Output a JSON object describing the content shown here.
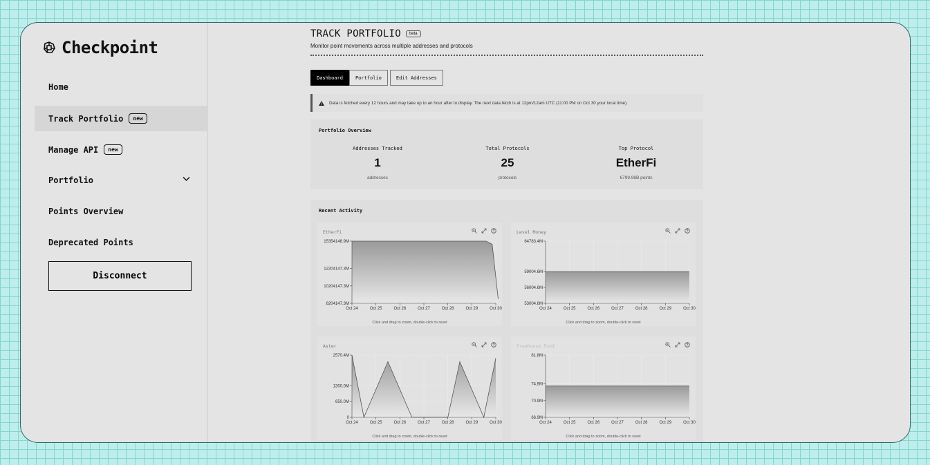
{
  "app": {
    "name": "Checkpoint"
  },
  "sidebar": {
    "items": [
      {
        "label": "Home"
      },
      {
        "label": "Track Portfolio",
        "badge": "new"
      },
      {
        "label": "Manage API",
        "badge": "new"
      },
      {
        "label": "Portfolio"
      },
      {
        "label": "Points Overview"
      },
      {
        "label": "Deprecated Points"
      }
    ],
    "disconnect_label": "Disconnect"
  },
  "page": {
    "title": "TRACK PORTFOLIO",
    "badge": "beta",
    "subtitle": "Monitor point movements across multiple addresses and protocols"
  },
  "tabs": [
    {
      "label": "Dashboard",
      "active": true
    },
    {
      "label": "Portfolio",
      "active": false
    },
    {
      "label": "Edit Addresses",
      "active": false
    }
  ],
  "notice": {
    "text": "Data is fetched every 12 hours and may take up to an hour after to display. The next data fetch is at 12pm/12am UTC (11:00 PM on Oct 30 your local time)."
  },
  "overview": {
    "title": "Portfolio Overview",
    "stats": [
      {
        "label": "Addresses Tracked",
        "value": "1",
        "sub": "addresses"
      },
      {
        "label": "Total Protocols",
        "value": "25",
        "sub": "protocols"
      },
      {
        "label": "Top Protocol",
        "value": "EtherFi",
        "sub": "6799.98B points"
      }
    ]
  },
  "activity": {
    "title": "Recent Activity",
    "chart_hint": "Click and drag to zoom, double-click to reset"
  },
  "chart_data": [
    {
      "type": "area",
      "title": "EtherFi",
      "x": [
        "Oct 24",
        "Oct 25",
        "Oct 26",
        "Oct 27",
        "Oct 28",
        "Oct 29",
        "Oct 30"
      ],
      "y_ticks": [
        "15354148.9M",
        "12204147.3M",
        "10204147.3M",
        "8204147.3M"
      ],
      "y_tick_values": [
        15354148.9,
        12204147.3,
        10204147.3,
        8204147.3
      ],
      "ylim": [
        8204147.3,
        15354148.9
      ],
      "series": [
        {
          "values": [
            15354148.9,
            15354148.9,
            15354148.9,
            15354148.9,
            15354148.9,
            15354148.9,
            15354148.9,
            15354148.9,
            15354148.9,
            15354148.9,
            15354148.9,
            15354148.9,
            15354148.9,
            15000000,
            8700000
          ],
          "x_pos": [
            0,
            0.5,
            1,
            1.5,
            2,
            2.5,
            3,
            3.5,
            4,
            4.5,
            5,
            5.4,
            5.6,
            5.85,
            6.1
          ]
        }
      ]
    },
    {
      "type": "area",
      "title": "Level Money",
      "x": [
        "Oct 24",
        "Oct 25",
        "Oct 26",
        "Oct 27",
        "Oct 28",
        "Oct 29",
        "Oct 30"
      ],
      "y_ticks": [
        "64783.4M",
        "59004.6M",
        "56004.6M",
        "53004.6M"
      ],
      "y_tick_values": [
        64783.4,
        59004.6,
        56004.6,
        53004.6
      ],
      "ylim": [
        53004.6,
        64783.4
      ],
      "series": [
        {
          "values": [
            59004.6,
            59004.6,
            59004.6,
            59004.6,
            59004.6,
            59004.6,
            59004.6
          ],
          "x_pos": [
            0,
            1,
            2,
            3,
            4,
            5,
            6
          ]
        }
      ]
    },
    {
      "type": "area",
      "title": "Aster",
      "x": [
        "Oct 24",
        "Oct 25",
        "Oct 26",
        "Oct 27",
        "Oct 28",
        "Oct 29",
        "Oct 30"
      ],
      "y_ticks": [
        "2570.4M",
        "1300.0M",
        "650.0M",
        "0"
      ],
      "y_tick_values": [
        2570.4,
        1300,
        650,
        0
      ],
      "ylim": [
        0,
        2570.4
      ],
      "series": [
        {
          "values": [
            2570.4,
            0,
            2300,
            0,
            0,
            0,
            0,
            2300,
            0,
            2450
          ],
          "x_pos": [
            0,
            0.5,
            1.5,
            2.5,
            3,
            3.5,
            4,
            4.5,
            5.5,
            6
          ]
        }
      ]
    },
    {
      "type": "area",
      "title": "Treehouse Fund",
      "x": [
        "Oct 24",
        "Oct 25",
        "Oct 26",
        "Oct 27",
        "Oct 28",
        "Oct 29",
        "Oct 30"
      ],
      "y_ticks": [
        "81.8M",
        "74.9M",
        "70.9M",
        "66.9M"
      ],
      "y_tick_values": [
        81.8,
        74.9,
        70.9,
        66.9
      ],
      "ylim": [
        66.9,
        81.8
      ],
      "series": [
        {
          "values": [
            74.4,
            74.4,
            74.4,
            74.4,
            74.4,
            74.4,
            74.4
          ],
          "x_pos": [
            0,
            1,
            2,
            3,
            4,
            5,
            6
          ]
        }
      ]
    }
  ],
  "colors": {
    "grid_bg": "#bdeeec",
    "window_border": "#2d6b68",
    "accent": "#000000"
  }
}
